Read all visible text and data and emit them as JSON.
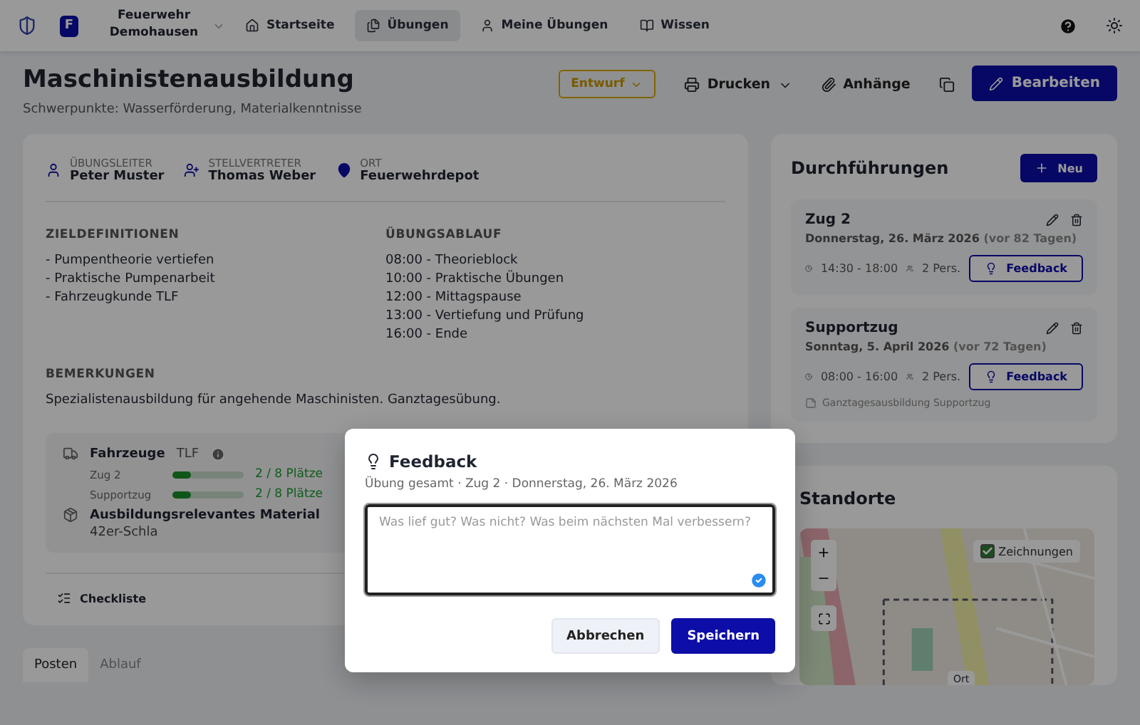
{
  "nav": {
    "org_badge": "F",
    "org_name": "Feuerwehr Demohausen",
    "items": [
      {
        "label": "Startseite",
        "selected": false
      },
      {
        "label": "Übungen",
        "selected": true
      },
      {
        "label": "Meine Übungen",
        "selected": false
      },
      {
        "label": "Wissen",
        "selected": false
      }
    ]
  },
  "header": {
    "title": "Maschinistenausbildung",
    "subtitle": "Schwerpunkte: Wasserförderung, Materialkenntnisse",
    "status": "Entwurf",
    "print": "Drucken",
    "attachments": "Anhänge",
    "edit": "Bearbeiten"
  },
  "people": [
    {
      "label": "ÜBUNGSLEITER",
      "value": "Peter Muster"
    },
    {
      "label": "STELLVERTRETER",
      "value": "Thomas Weber"
    },
    {
      "label": "ORT",
      "value": "Feuerwehrdepot"
    }
  ],
  "goals": {
    "title": "ZIELDEFINITIONEN",
    "lines": [
      "- Pumpentheorie vertiefen",
      "- Praktische Pumpenarbeit",
      "- Fahrzeugkunde TLF"
    ]
  },
  "schedule": {
    "title": "ÜBUNGSABLAUF",
    "lines": [
      "08:00 - Theorieblock",
      "10:00 - Praktische Übungen",
      "12:00 - Mittagspause",
      "13:00 - Vertiefung und Prüfung",
      "16:00 - Ende"
    ]
  },
  "remarks": {
    "title": "BEMERKUNGEN",
    "text": "Spezialistenausbildung für angehende Maschinisten. Ganztagesübung."
  },
  "resources": {
    "vehicles_label": "Fahrzeuge",
    "vehicles_tag": "TLF",
    "vehicles": [
      {
        "name": "Zug 2",
        "level": 0.25,
        "reading": "2 / 8 Plätze"
      },
      {
        "name": "Supportzug",
        "level": 0.25,
        "reading": "2 / 8 Plätze"
      }
    ],
    "material_label": "Ausbildungsrelevantes Material",
    "material_value": "42er-Schla"
  },
  "checklist": "Checkliste",
  "tabs": [
    {
      "label": "Posten",
      "selected": true
    },
    {
      "label": "Ablauf",
      "selected": false
    }
  ],
  "runs": {
    "title": "Durchführungen",
    "new": "Neu",
    "items": [
      {
        "title": "Zug 2",
        "date": "Donnerstag, 26. März 2026",
        "relative": "(vor 82 Tagen)",
        "time": "14:30 - 18:00",
        "persons": "2 Pers.",
        "feedback": "Feedback"
      },
      {
        "title": "Supportzug",
        "date": "Sonntag, 5. April 2026",
        "relative": "(vor 72 Tagen)",
        "time": "08:00 - 16:00",
        "persons": "2 Pers.",
        "feedback": "Feedback",
        "note": "Ganztagesausbildung Supportzug"
      }
    ]
  },
  "locations": {
    "title": "Standorte",
    "layer_toggle": {
      "label": "Zeichnungen",
      "checked": true
    },
    "marker": "Ort"
  },
  "modal": {
    "title": "Feedback",
    "subtitle": "Übung gesamt · Zug 2 · Donnerstag, 26. März 2026",
    "placeholder": "Was lief gut? Was nicht? Was beim nächsten Mal verbessern?",
    "cancel": "Abbrechen",
    "save": "Speichern"
  }
}
